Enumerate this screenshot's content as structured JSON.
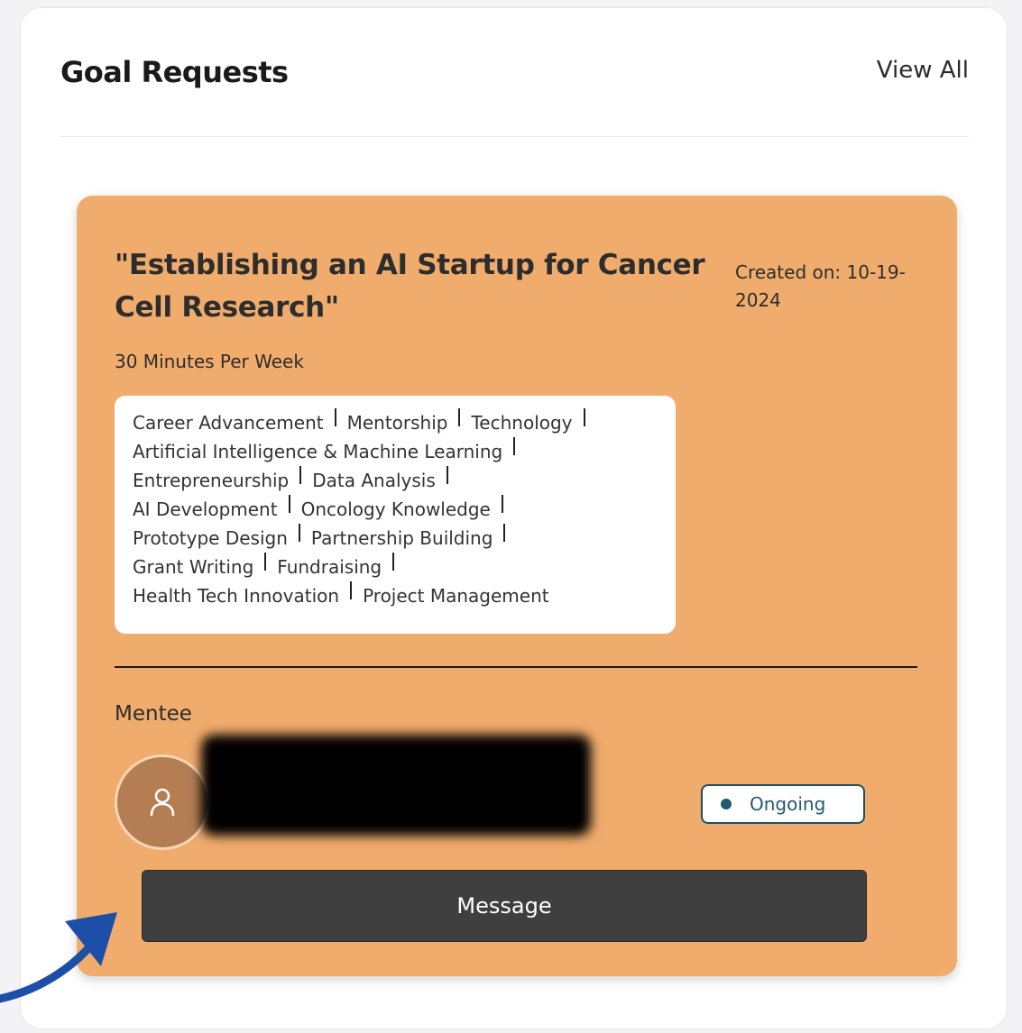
{
  "panel": {
    "title": "Goal Requests",
    "view_all_label": "View All"
  },
  "goal_card": {
    "title": "\"Establishing an AI Startup for Cancer Cell Research\"",
    "created_on": "Created on: 10-19-2024",
    "time_commitment": "30 Minutes Per Week",
    "tag_lines": [
      [
        "Career Advancement",
        "Mentorship",
        "Technology"
      ],
      [
        "Artificial Intelligence & Machine Learning"
      ],
      [
        "Entrepreneurship",
        "Data Analysis"
      ],
      [
        "AI Development",
        "Oncology Knowledge"
      ],
      [
        "Prototype Design",
        "Partnership Building"
      ],
      [
        "Grant Writing",
        "Fundraising"
      ],
      [
        "Health Tech Innovation",
        "Project Management"
      ]
    ],
    "mentee_label": "Mentee",
    "status": "Ongoing",
    "message_label": "Message"
  },
  "colors": {
    "card_background": "#f0ac6c",
    "button_background": "#3f3f3f",
    "status_accent": "#1f5a73",
    "annotation_arrow": "#1d4fa8"
  },
  "icons": {
    "avatar": "user-icon",
    "annotation": "curved-arrow-icon"
  }
}
